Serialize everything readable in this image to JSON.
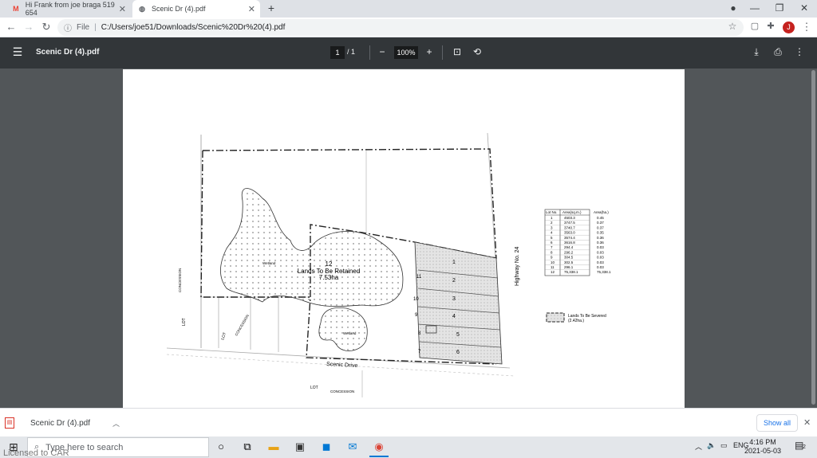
{
  "tabs": [
    {
      "label": "Hi Frank from joe braga 519 654",
      "icon": "gmail-icon"
    },
    {
      "label": "Scenic Dr (4).pdf",
      "icon": "pdf-icon"
    }
  ],
  "address": {
    "scheme_label": "File",
    "url": "C:/Users/joe51/Downloads/Scenic%20Dr%20(4).pdf"
  },
  "profile_initial": "J",
  "pdf_toolbar": {
    "title": "Scenic Dr (4).pdf",
    "page_current": "1",
    "page_sep": "/",
    "page_total": "1",
    "zoom": "100%"
  },
  "drawing": {
    "retained_lot": "12",
    "retained_label": "Lands To Be Retained",
    "retained_area": "7.53ha",
    "wetland_labels": [
      "Wetland",
      "Wetland"
    ],
    "road_label": "Scenic   Drive",
    "highway_label": "Highway  No.  24",
    "concession_labels": [
      "CONCESSION",
      "CONCESSION",
      "CONCESSION"
    ],
    "lot_labels": [
      "LOT",
      "LOT",
      "LOT"
    ],
    "small_lot_numbers": [
      "1",
      "2",
      "3",
      "4",
      "5",
      "6",
      "7",
      "8",
      "9",
      "10",
      "11"
    ],
    "legend_label": "Lands To Be Severed",
    "legend_area": "(2.42ha.)"
  },
  "area_table": {
    "headers": [
      "Lot No.",
      "Area(sq.m.)",
      "Area(ha.)"
    ],
    "rows": [
      [
        "1",
        "4503.3",
        "0.45"
      ],
      [
        "2",
        "3747.5",
        "0.37"
      ],
      [
        "3",
        "3740.7",
        "0.37"
      ],
      [
        "4",
        "3563.0",
        "0.35"
      ],
      [
        "5",
        "3574.4",
        "0.36"
      ],
      [
        "6",
        "3616.8",
        "0.36"
      ],
      [
        "7",
        "294.4",
        "0.03"
      ],
      [
        "8",
        "296.2",
        "0.03"
      ],
      [
        "9",
        "304.5",
        "0.03"
      ],
      [
        "10",
        "302.5",
        "0.03"
      ],
      [
        "11",
        "296.1",
        "0.03"
      ],
      [
        "12",
        "75,338.1",
        "75,338.1"
      ]
    ]
  },
  "downloads": {
    "file_name": "Scenic Dr (4).pdf",
    "show_all": "Show all"
  },
  "taskbar": {
    "search_placeholder": "Type here to search",
    "language": "ENG",
    "time": "4:16 PM",
    "date": "2021-05-03",
    "notification_count": "2",
    "watermark": "Licensed to CAR"
  }
}
